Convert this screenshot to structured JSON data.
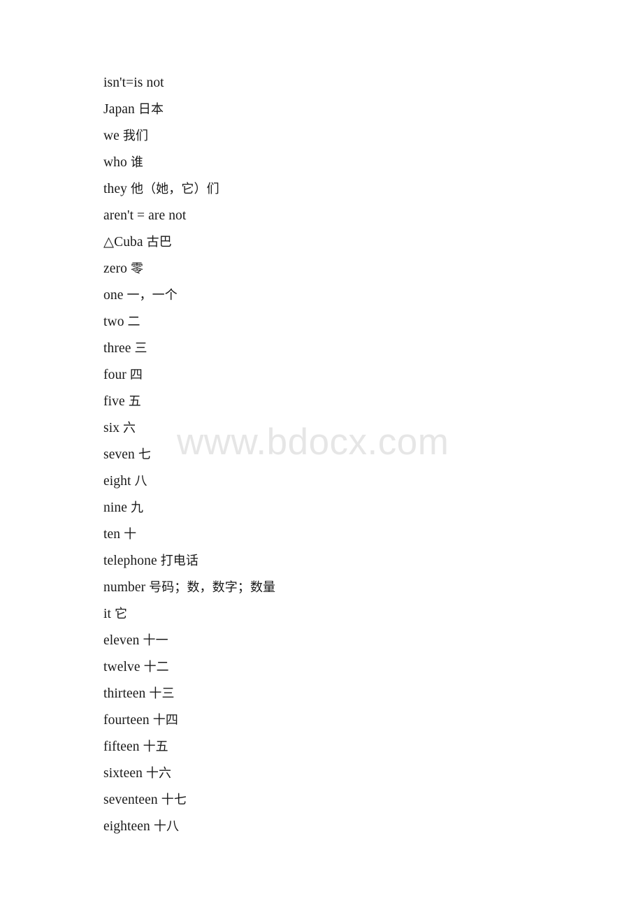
{
  "document": {
    "page_background": "#ffffff",
    "text_color": "#1a1a1a",
    "watermark": {
      "text": "www.bdocx.com",
      "color": "#e6e6e6"
    },
    "lines": [
      {
        "english": "isn't=is not",
        "chinese": ""
      },
      {
        "english": "Japan",
        "chinese": "日本"
      },
      {
        "english": "we",
        "chinese": "我们"
      },
      {
        "english": "who",
        "chinese": "谁"
      },
      {
        "english": "they",
        "chinese": "他（她，它）们"
      },
      {
        "english": "aren't = are not",
        "chinese": ""
      },
      {
        "english": "△Cuba",
        "chinese": "古巴"
      },
      {
        "english": "zero",
        "chinese": "零"
      },
      {
        "english": "one",
        "chinese": "一，一个"
      },
      {
        "english": "two",
        "chinese": "二"
      },
      {
        "english": "three",
        "chinese": "三"
      },
      {
        "english": "four",
        "chinese": "四"
      },
      {
        "english": "five",
        "chinese": "五"
      },
      {
        "english": "six",
        "chinese": "六"
      },
      {
        "english": "seven",
        "chinese": "七"
      },
      {
        "english": "eight",
        "chinese": "八"
      },
      {
        "english": "nine",
        "chinese": "九"
      },
      {
        "english": "ten",
        "chinese": "十"
      },
      {
        "english": "telephone",
        "chinese": "打电话"
      },
      {
        "english": "number",
        "chinese": "号码；数，数字；数量"
      },
      {
        "english": "it",
        "chinese": "它"
      },
      {
        "english": "eleven",
        "chinese": "十一"
      },
      {
        "english": "twelve",
        "chinese": "十二"
      },
      {
        "english": "thirteen",
        "chinese": "十三"
      },
      {
        "english": "fourteen",
        "chinese": "十四"
      },
      {
        "english": "fifteen",
        "chinese": "十五"
      },
      {
        "english": "sixteen",
        "chinese": "十六"
      },
      {
        "english": "seventeen",
        "chinese": "十七"
      },
      {
        "english": "eighteen",
        "chinese": "十八"
      }
    ]
  }
}
